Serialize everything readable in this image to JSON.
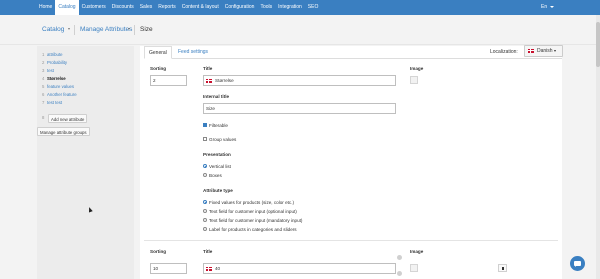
{
  "nav": {
    "items": [
      "Home",
      "Catalog",
      "Customers",
      "Discounts",
      "Sales",
      "Reports",
      "Content & layout",
      "Configuration",
      "Tools",
      "Integration",
      "SEO"
    ],
    "active_index": 1,
    "language": "En"
  },
  "breadcrumb": {
    "items": [
      "Catalog",
      "Manage Attributes",
      "Size"
    ]
  },
  "sidebar": {
    "attributes": [
      {
        "num": "1",
        "label": "attribute"
      },
      {
        "num": "2",
        "label": "Probability"
      },
      {
        "num": "3",
        "label": "test"
      },
      {
        "num": "4",
        "label": "Størrelse"
      },
      {
        "num": "5",
        "label": "feature values"
      },
      {
        "num": "6",
        "label": "Another feature"
      },
      {
        "num": "7",
        "label": "test test"
      }
    ],
    "selected_index": 3,
    "add_button_num": "8",
    "add_button": "Add new attribute",
    "manage_groups_button": "Manage attribute groups"
  },
  "tabs": [
    "General",
    "Feed settings"
  ],
  "localization": {
    "label": "Localization:",
    "value": "Danish"
  },
  "form": {
    "sorting_label": "Sorting",
    "sorting_value": "2",
    "title_label": "Title",
    "title_value": "Størrelse",
    "image_label": "Image",
    "internal_title_label": "Internal title",
    "internal_title_value": "Size",
    "filterable_label": "Filterable",
    "filterable_checked": true,
    "group_values_label": "Group values",
    "group_values_checked": false,
    "presentation_label": "Presentation",
    "presentation_options": [
      "Vertical list",
      "Boxes"
    ],
    "presentation_selected": 0,
    "attribute_type_label": "Attribute type",
    "attribute_type_options": [
      "Fixed values for products (size, color etc.)",
      "Text field for customer input (optional input)",
      "Text field for customer input (mandatory input)",
      "Label for products in categories and sliders"
    ],
    "attribute_type_selected": 0
  },
  "value_row": {
    "sorting_label": "Sorting",
    "sorting_value": "10",
    "title_label": "Title",
    "title_value": "40",
    "image_label": "Image"
  },
  "colors": {
    "nav_bg": "#3a7fc1",
    "link": "#3a7fc1",
    "flag_red": "#c8102e"
  }
}
